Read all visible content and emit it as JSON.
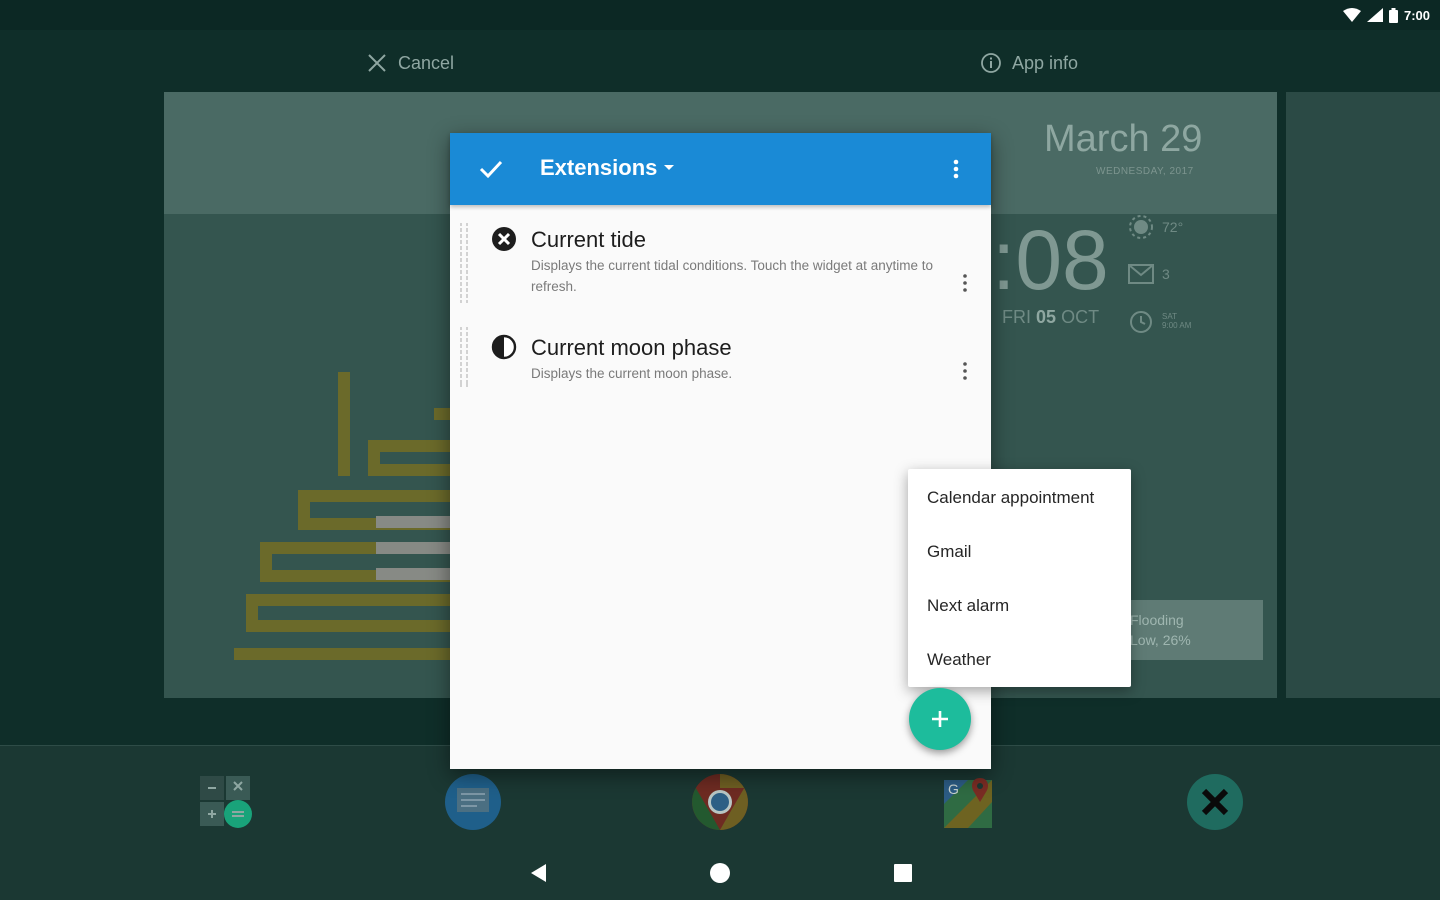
{
  "status_bar": {
    "time": "7:00"
  },
  "action_bar": {
    "cancel_label": "Cancel",
    "app_info_label": "App info"
  },
  "background_widget": {
    "date": "March 29",
    "date_sub": "WEDNESDAY, 2017",
    "clock": ":08",
    "clock_day": "FRI",
    "clock_daynum": "05",
    "clock_month": "OCT",
    "weather_temp": "72°",
    "mail_count": "3",
    "alarm_day": "SAT",
    "alarm_time": "9:00 AM",
    "flood_title": "Flooding",
    "flood_sub": "Low, 26%"
  },
  "dialog": {
    "title": "Extensions",
    "extensions": [
      {
        "name": "Current tide",
        "description": "Displays the current tidal conditions. Touch the widget at anytime to refresh.",
        "icon": "close-circle-icon"
      },
      {
        "name": "Current moon phase",
        "description": "Displays the current moon phase.",
        "icon": "moon-phase-icon"
      }
    ]
  },
  "popup_menu": {
    "items": [
      "Calendar appointment",
      "Gmail",
      "Next alarm",
      "Weather"
    ]
  },
  "dock": {
    "apps": [
      "calculator-icon",
      "messages-icon",
      "chrome-icon",
      "maps-icon",
      "close-app-icon"
    ]
  },
  "colors": {
    "toolbar": "#1a8ad6",
    "fab": "#1dbc9c",
    "background": "#0f2e29"
  }
}
